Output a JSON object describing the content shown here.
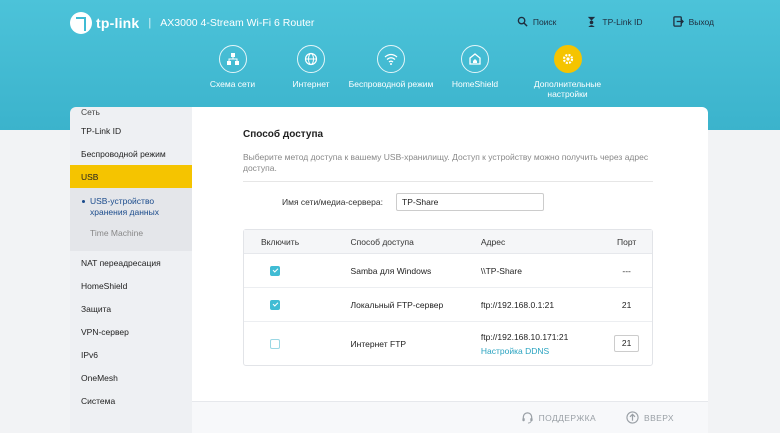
{
  "header": {
    "logo_text": "tp-link",
    "separator": "|",
    "model": "AX3000 4-Stream Wi-Fi 6 Router",
    "links": [
      {
        "label": "Поиск",
        "icon": "search-icon"
      },
      {
        "label": "TP-Link ID",
        "icon": "user-id-icon"
      },
      {
        "label": "Выход",
        "icon": "logout-icon"
      }
    ]
  },
  "nav": [
    {
      "label": "Схема сети",
      "icon": "network-map-icon"
    },
    {
      "label": "Интернет",
      "icon": "globe-icon"
    },
    {
      "label": "Беспроводной режим",
      "icon": "wifi-icon"
    },
    {
      "label": "HomeShield",
      "icon": "home-shield-icon"
    },
    {
      "label": "Дополнительные настройки",
      "icon": "gear-icon",
      "active": true
    }
  ],
  "sidebar": {
    "items_top": [
      "Сеть",
      "TP-Link ID",
      "Беспроводной режим",
      "USB"
    ],
    "sub": [
      "USB-устройство хранения данных",
      "Time Machine"
    ],
    "items_bottom": [
      "NAT переадресация",
      "HomeShield",
      "Защита",
      "VPN-сервер",
      "IPv6",
      "OneMesh",
      "Система"
    ]
  },
  "main": {
    "title": "Способ доступа",
    "desc": "Выберите метод доступа к вашему USB-хранилищу. Доступ к устройству можно получить через адрес доступа.",
    "server_label": "Имя сети/медиа-сервера:",
    "server_value": "TP-Share",
    "table": {
      "headers": [
        "Включить",
        "Способ доступа",
        "Адрес",
        "Порт"
      ],
      "rows": [
        {
          "enabled": true,
          "method": "Samba для Windows",
          "address": "\\\\TP-Share",
          "port": "---"
        },
        {
          "enabled": true,
          "method": "Локальный FTP-сервер",
          "address": "ftp://192.168.0.1:21",
          "port": "21"
        },
        {
          "enabled": false,
          "method": "Интернет FTP",
          "address": "ftp://192.168.10.171:21",
          "link": "Настройка DDNS",
          "port": "21"
        }
      ]
    }
  },
  "footer": {
    "support": "ПОДДЕРЖКА",
    "top": "ВВЕРХ"
  },
  "colors": {
    "header_bg": "#40bcd4",
    "accent": "#f5c400",
    "link": "#2aa3c0"
  }
}
